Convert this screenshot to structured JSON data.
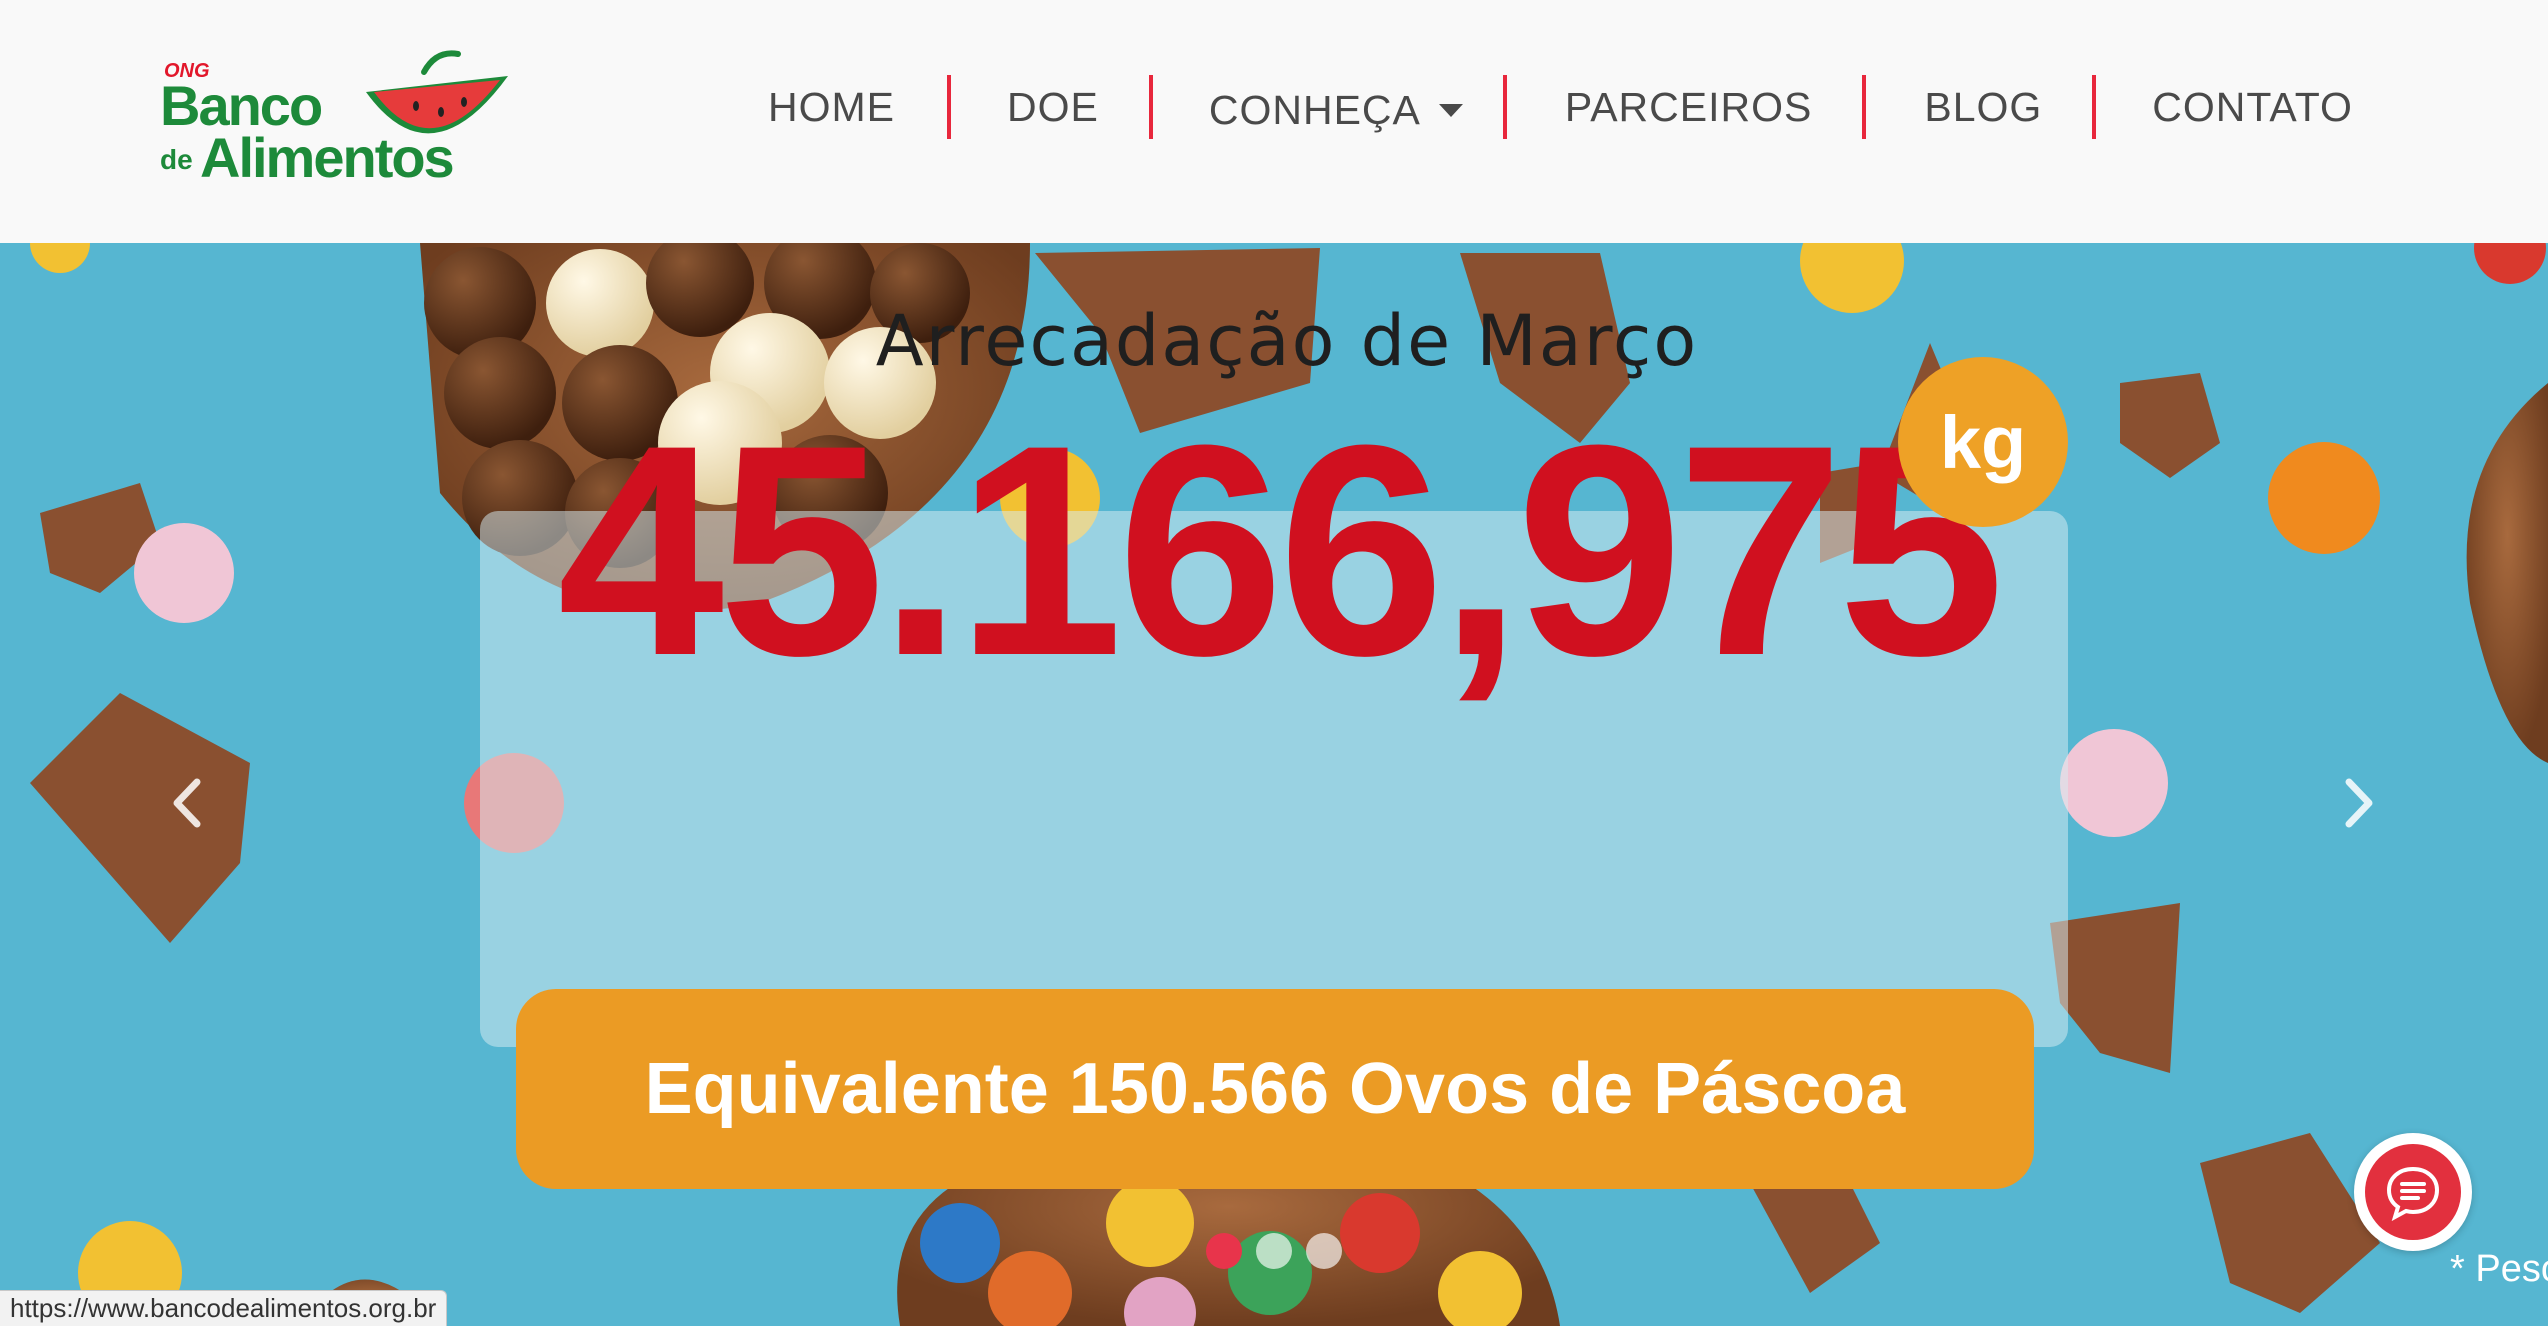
{
  "logo": {
    "ong": "ONG",
    "line1": "Banco",
    "line2_small": "de",
    "line2": "Alimentos",
    "colors": {
      "green": "#1d8a3a",
      "red": "#e2172b"
    }
  },
  "nav": {
    "items": [
      {
        "label": "HOME"
      },
      {
        "label": "DOE"
      },
      {
        "label": "CONHEÇA",
        "has_dropdown": true
      },
      {
        "label": "PARCEIROS"
      },
      {
        "label": "BLOG"
      },
      {
        "label": "CONTATO"
      }
    ],
    "separator_color": "#e8273c"
  },
  "hero": {
    "title": "Arrecadação de Março",
    "amount": "45.166,975",
    "unit": "kg",
    "equivalent": "Equivalente 150.566 Ovos de Páscoa",
    "slides": {
      "count": 3,
      "active_index": 0
    },
    "colors": {
      "amount": "#d0101f",
      "badge": "#eea126",
      "banner": "#eb9b24",
      "background": "#56b6d1"
    }
  },
  "carousel": {
    "prev_icon": "chevron-left-icon",
    "next_icon": "chevron-right-icon"
  },
  "chat": {
    "icon": "chat-icon"
  },
  "footnote": "* Peso",
  "status_bar": {
    "url": "https://www.bancodealimentos.org.br"
  }
}
